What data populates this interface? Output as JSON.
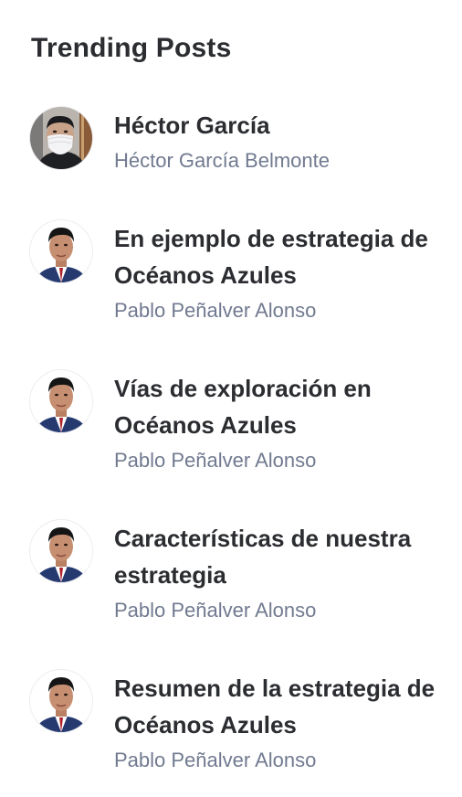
{
  "widget": {
    "title": "Trending Posts"
  },
  "posts": [
    {
      "title": "Héctor García",
      "author": "Héctor García Belmonte",
      "avatar_icon": "avatar-masked-man-photo"
    },
    {
      "title": "En ejemplo de estrategia de Océanos Azules",
      "author": "Pablo Peñalver Alonso",
      "avatar_icon": "avatar-man-in-suit-photo"
    },
    {
      "title": "Vías de exploración en Océanos Azules",
      "author": "Pablo Peñalver Alonso",
      "avatar_icon": "avatar-man-in-suit-photo"
    },
    {
      "title": "Características de nuestra estrategia",
      "author": "Pablo Peñalver Alonso",
      "avatar_icon": "avatar-man-in-suit-photo"
    },
    {
      "title": "Resumen de la estrategia de Océanos Azules",
      "author": "Pablo Peñalver Alonso",
      "avatar_icon": "avatar-man-in-suit-photo"
    }
  ]
}
